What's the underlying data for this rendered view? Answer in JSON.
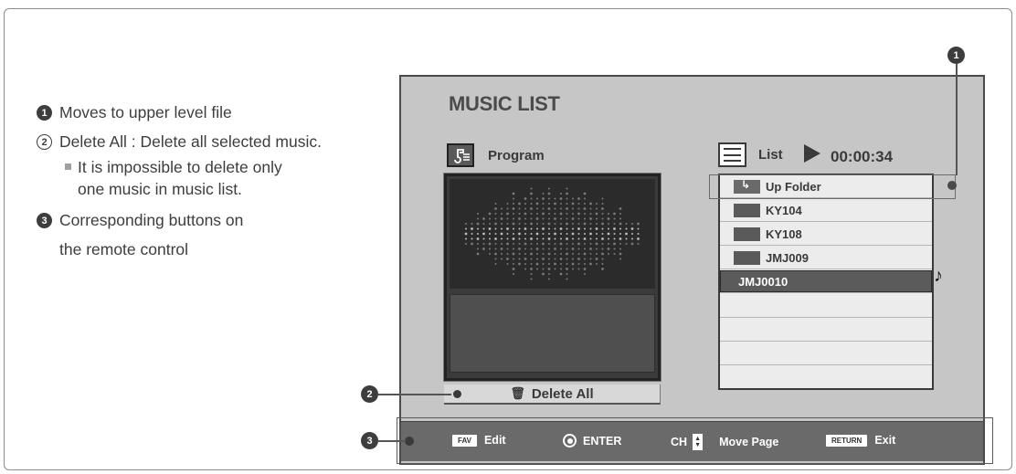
{
  "notes": [
    {
      "num": "1",
      "text": "Moves to upper level file"
    },
    {
      "num": "2",
      "text": "Delete All : Delete all selected music.",
      "sub": "It is impossible to delete only one music in music list."
    },
    {
      "num": "3",
      "text": "Corresponding buttons on the remote control"
    }
  ],
  "screen": {
    "title": "MUSIC LIST",
    "program_label": "Program",
    "list_label": "List",
    "time": "00:00:34",
    "delete_all": "Delete All",
    "files": [
      "Up Folder",
      "KY104",
      "KY108",
      "JMJ009",
      "JMJ0010"
    ],
    "selected_index": 4
  },
  "legend": {
    "fav_key": "FAV",
    "fav_label": "Edit",
    "enter_label": "ENTER",
    "ch_key": "CH",
    "ch_label": "Move Page",
    "return_key": "RETURN",
    "return_label": "Exit"
  },
  "callouts": {
    "c1": "1",
    "c2": "2",
    "c3": "3"
  },
  "colors": {
    "screen_bg": "#c6c6c6",
    "legend_bg": "#6a6a6a",
    "selected_row": "#5b5b5b"
  }
}
